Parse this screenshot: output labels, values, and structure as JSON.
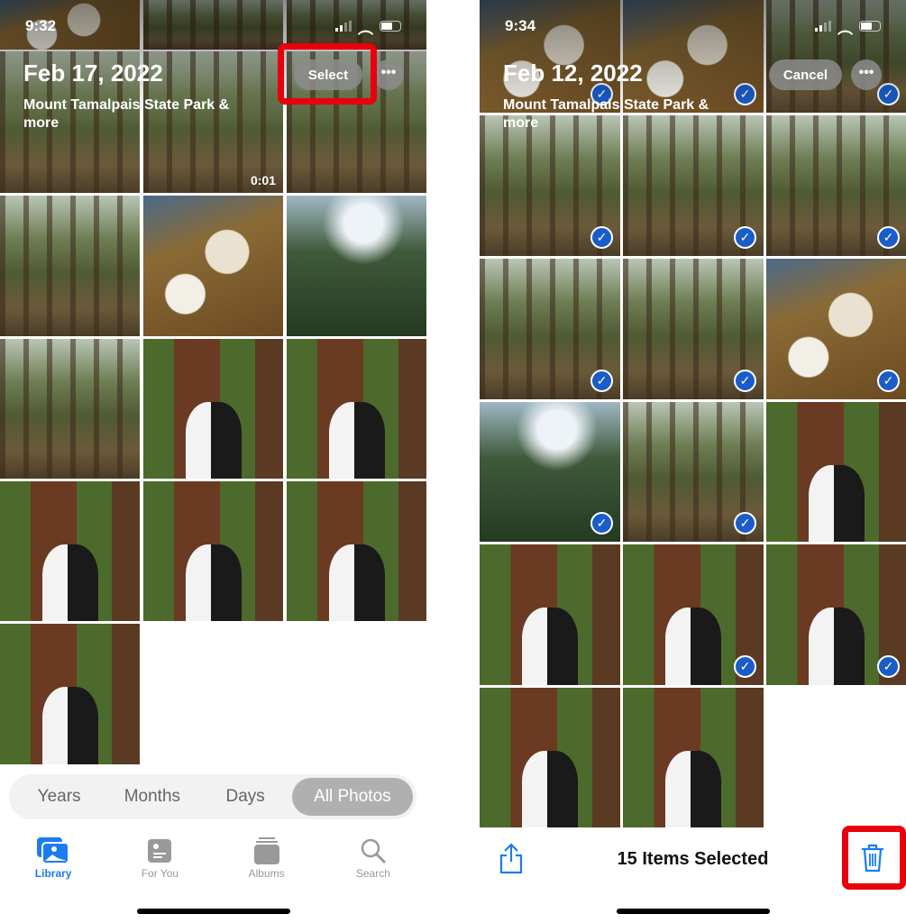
{
  "left": {
    "status": {
      "time": "9:32"
    },
    "header": {
      "date": "Feb 17, 2022",
      "location": "Mount Tamalpais State Park & more",
      "select_label": "Select",
      "more_label": "•••"
    },
    "video_duration": "0:01",
    "segments": [
      {
        "label": "Years"
      },
      {
        "label": "Months"
      },
      {
        "label": "Days"
      },
      {
        "label": "All Photos",
        "selected": true
      }
    ],
    "tabs": [
      {
        "label": "Library",
        "icon": "photo-library-icon",
        "active": true
      },
      {
        "label": "For You",
        "icon": "for-you-icon"
      },
      {
        "label": "Albums",
        "icon": "albums-icon"
      },
      {
        "label": "Search",
        "icon": "search-icon"
      }
    ]
  },
  "right": {
    "status": {
      "time": "9:34"
    },
    "header": {
      "date": "Feb 12, 2022",
      "location": "Mount Tamalpais State Park & more",
      "cancel_label": "Cancel",
      "more_label": "•••"
    },
    "toolbar": {
      "selected_count": "15 Items Selected",
      "share_icon": "share-icon",
      "delete_icon": "trash-icon"
    }
  },
  "colors": {
    "accent": "#1a7cf0",
    "highlight": "#e8000b",
    "check": "#1a5cc8"
  }
}
